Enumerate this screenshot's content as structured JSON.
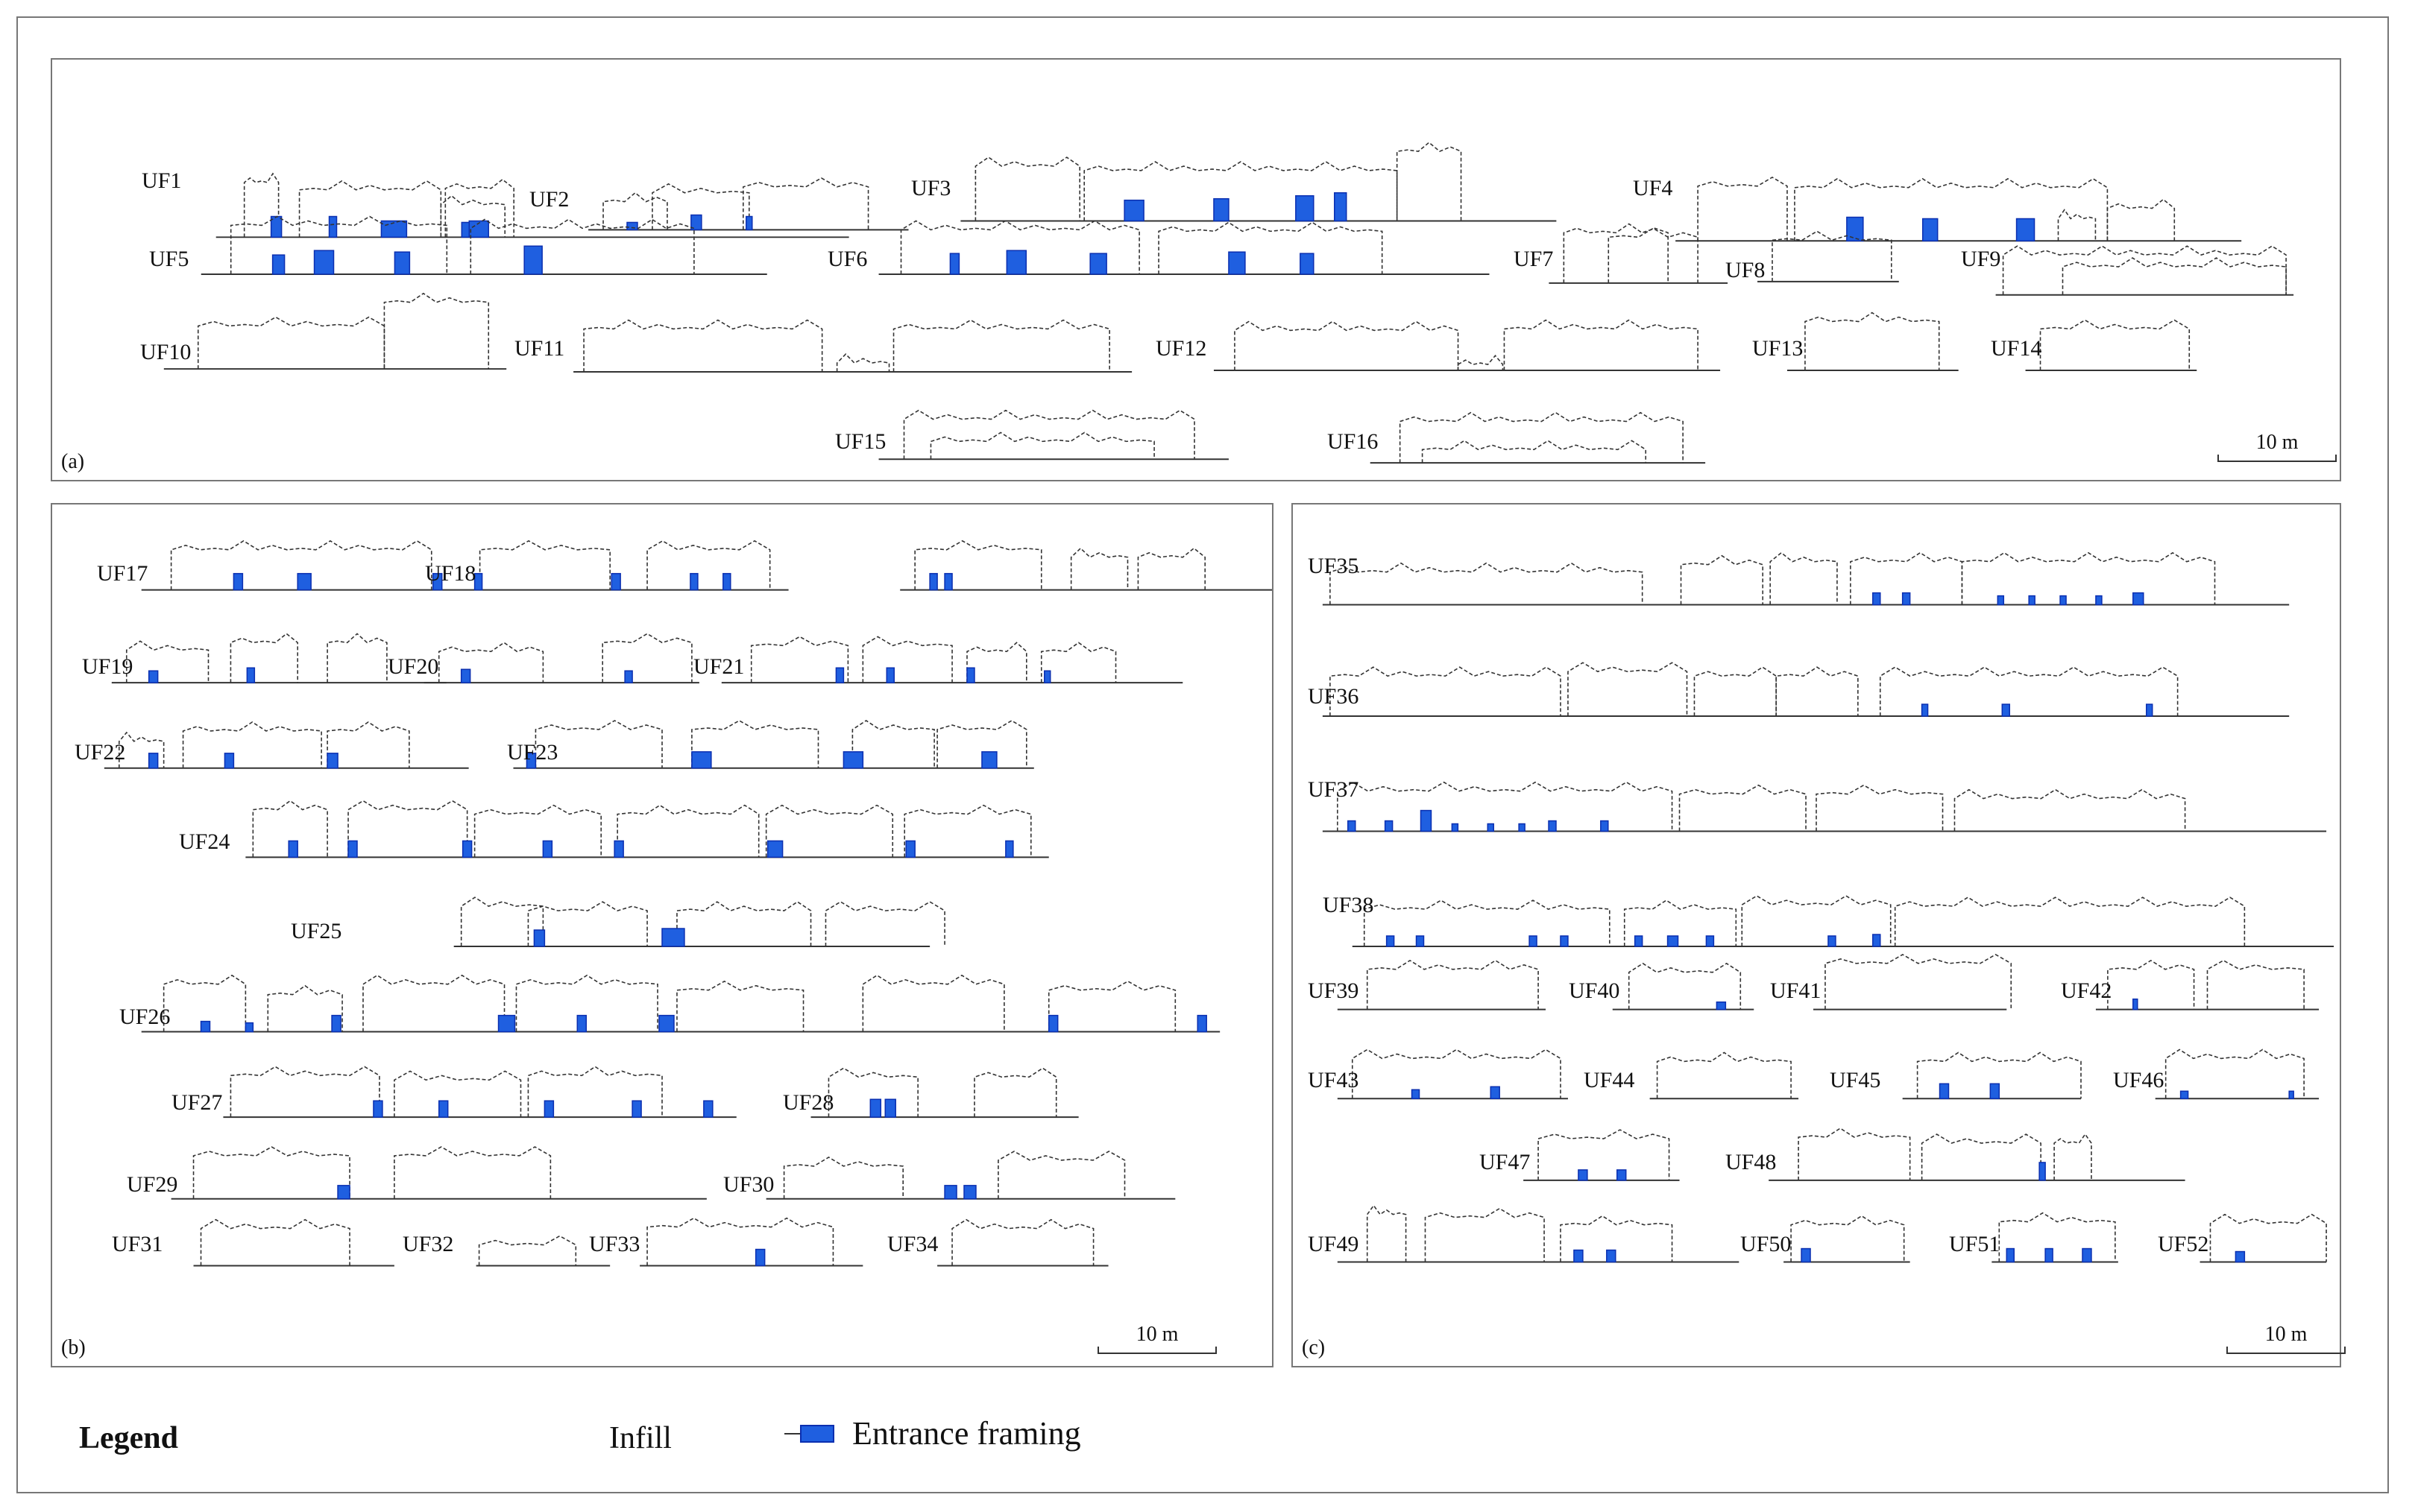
{
  "panels": {
    "a": {
      "letter": "(a)",
      "scale": "10 m",
      "units": [
        "UF1",
        "UF2",
        "UF3",
        "UF4",
        "UF5",
        "UF6",
        "UF7",
        "UF8",
        "UF9",
        "UF10",
        "UF11",
        "UF12",
        "UF13",
        "UF14",
        "UF15",
        "UF16"
      ]
    },
    "b": {
      "letter": "(b)",
      "scale": "10 m",
      "units": [
        "UF17",
        "UF18",
        "UF19",
        "UF20",
        "UF21",
        "UF22",
        "UF23",
        "UF24",
        "UF25",
        "UF26",
        "UF27",
        "UF28",
        "UF29",
        "UF30",
        "UF31",
        "UF32",
        "UF33",
        "UF34"
      ]
    },
    "c": {
      "letter": "(c)",
      "scale": "10 m",
      "units": [
        "UF35",
        "UF36",
        "UF37",
        "UF38",
        "UF39",
        "UF40",
        "UF41",
        "UF42",
        "UF43",
        "UF44",
        "UF45",
        "UF46",
        "UF47",
        "UF48",
        "UF49",
        "UF50",
        "UF51",
        "UF52"
      ]
    }
  },
  "legend": {
    "title": "Legend",
    "infill": "Infill",
    "entrance_framing": "Entrance framing"
  },
  "colors": {
    "frame": "#777777",
    "outline": "#333333",
    "entrance_fill": "#1f5fe0",
    "entrance_stroke": "#0b2fb0"
  }
}
